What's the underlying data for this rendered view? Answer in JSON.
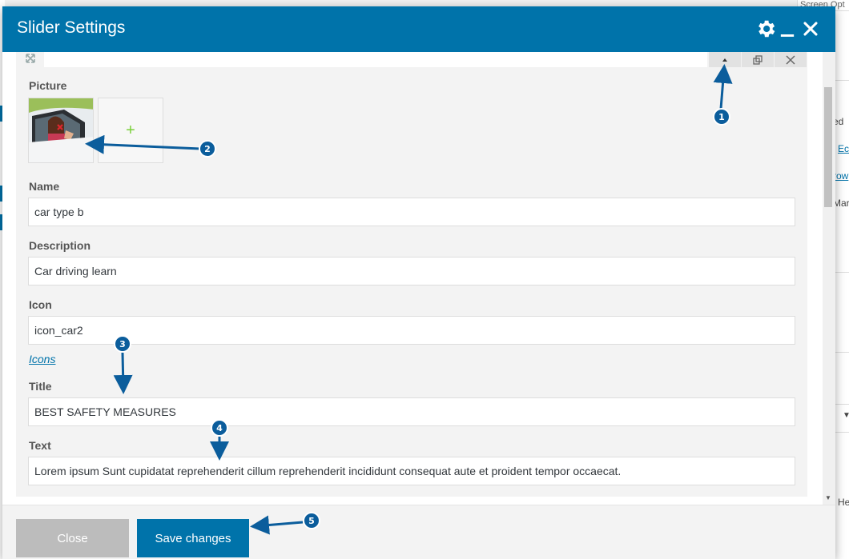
{
  "background": {
    "screen_options": "Screen Opt",
    "fragments": [
      "ed",
      "Ec",
      "row",
      "Mar",
      "He"
    ]
  },
  "modal": {
    "title": "Slider Settings",
    "header_icons": [
      "gear-icon",
      "minimize-icon",
      "close-icon"
    ],
    "colors": {
      "header": "#0073aa",
      "panel": "#f3f3f3",
      "accent_plus": "#7ad03a"
    }
  },
  "form": {
    "picture": {
      "label": "Picture",
      "add_symbol": "+"
    },
    "name": {
      "label": "Name",
      "value": "car type b"
    },
    "description": {
      "label": "Description",
      "value": "Car driving learn"
    },
    "icon": {
      "label": "Icon",
      "value": "icon_car2",
      "link": "Icons"
    },
    "title": {
      "label": "Title",
      "value": "BEST SAFETY MEASURES"
    },
    "text": {
      "label": "Text",
      "value": "Lorem ipsum Sunt cupidatat reprehenderit cillum reprehenderit incididunt consequat aute et proident tempor occaecat."
    }
  },
  "footer": {
    "close_label": "Close",
    "save_label": "Save changes"
  },
  "annotations": [
    "1",
    "2",
    "3",
    "4",
    "5"
  ]
}
